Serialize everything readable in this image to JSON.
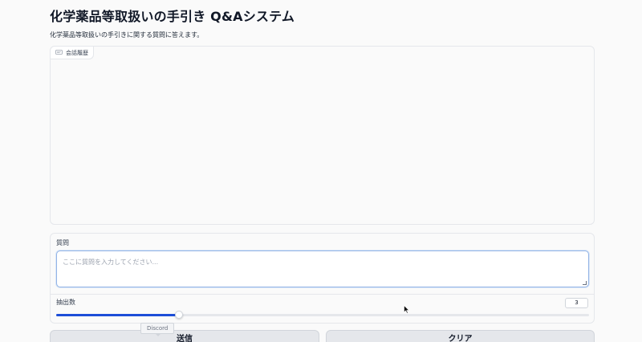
{
  "header": {
    "title": "化学薬品等取扱いの手引き Q&Aシステム",
    "description": "化学薬品等取扱いの手引きに関する質問に答えます。"
  },
  "chatbot": {
    "label": "会話履歴",
    "icon": "chat-bubble-icon"
  },
  "question": {
    "label": "質問",
    "placeholder": "ここに質問を入力してください..."
  },
  "slider": {
    "label": "抽出数",
    "value": "3",
    "fill_fraction": 0.23
  },
  "buttons": {
    "submit": "送信",
    "clear": "クリア"
  },
  "tooltip": {
    "text": "Discord"
  },
  "colors": {
    "accent": "#1d4ed8",
    "focus_border": "#93b4e6"
  }
}
